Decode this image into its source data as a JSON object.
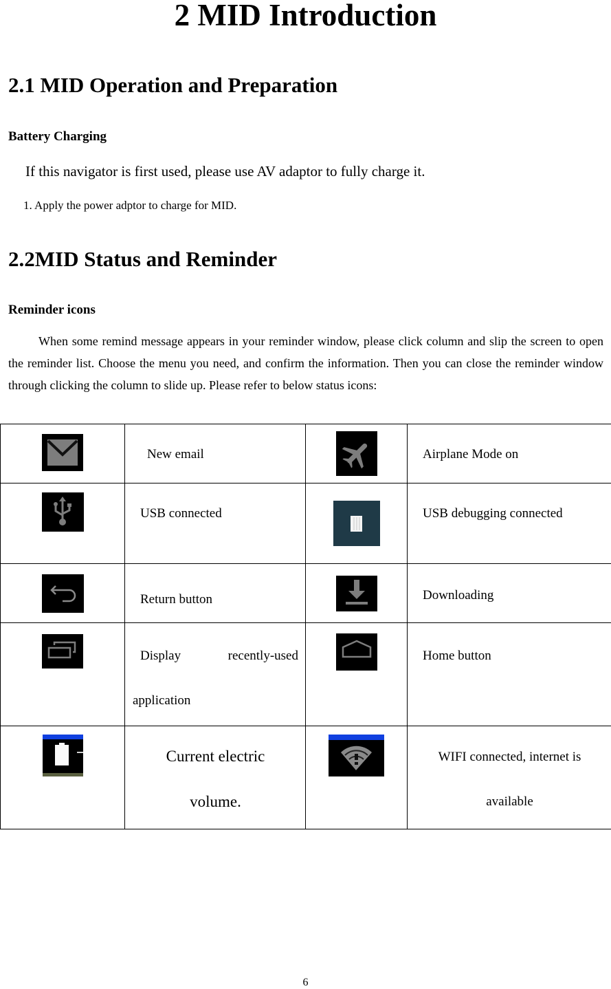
{
  "document": {
    "chapter_title": "2 MID Introduction",
    "section_1": {
      "title": "2.1 MID Operation and Preparation",
      "subheading": "Battery Charging",
      "intro": "If this navigator is first used, please use AV adaptor to fully charge it.",
      "step_1": "1. Apply the power adptor to charge for MID."
    },
    "section_2": {
      "title": "2.2MID Status and Reminder",
      "subheading": "Reminder icons",
      "paragraph": "When some remind message appears in your reminder window, please click column and slip the screen to open the reminder list. Choose the menu you need, and confirm the information. Then you can close the reminder window through clicking the column to slide up. Please refer to below status icons:"
    },
    "status_icons_table": {
      "rows": [
        {
          "left": {
            "icon": "email-icon",
            "label": "New email"
          },
          "right": {
            "icon": "airplane-icon",
            "label": "Airplane Mode on"
          }
        },
        {
          "left": {
            "icon": "usb-icon",
            "label": "USB connected"
          },
          "right": {
            "icon": "usb-debugging-icon",
            "label": "USB debugging connected"
          }
        },
        {
          "left": {
            "icon": "return-icon",
            "label": "Return button"
          },
          "right": {
            "icon": "download-icon",
            "label": "Downloading"
          }
        },
        {
          "left": {
            "icon": "recent-apps-icon",
            "label_line1": "Display",
            "label_line1b": "recently-used",
            "label_line2": "application"
          },
          "right": {
            "icon": "home-icon",
            "label": "Home button"
          }
        },
        {
          "left": {
            "icon": "battery-icon",
            "label_line1": "Current electric",
            "label_line2": "volume."
          },
          "right": {
            "icon": "wifi-icon",
            "label_line1": "WIFI connected, internet is",
            "label_line2": "available"
          }
        }
      ]
    },
    "page_number": "6"
  },
  "colors": {
    "icon_background": "#000000",
    "icon_glyph": "#7a7a7a",
    "usb_debug_background": "#1f3a47",
    "status_bar_blue": "#1040e0"
  }
}
